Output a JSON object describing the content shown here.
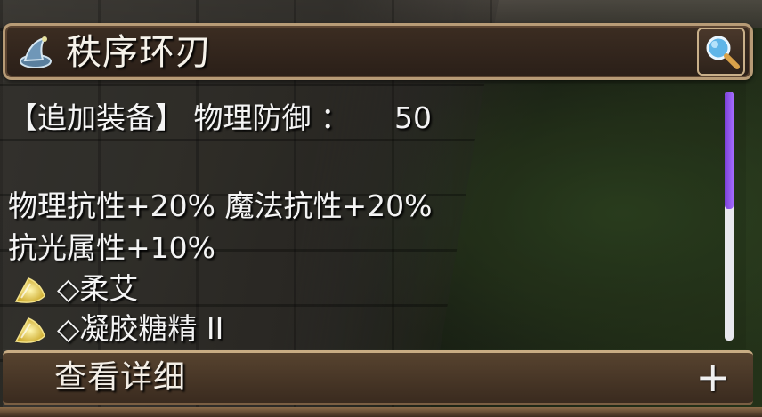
{
  "item": {
    "icon": "mage-hat-icon",
    "name": "秩序环刃",
    "search_icon": "magnifier-icon"
  },
  "stats": {
    "slot_label": "【追加装备】 物理防御 ：",
    "defense_value": "50",
    "resist_line": "物理抗性+20% 魔法抗性+20%",
    "light_line": "抗光属性+10%"
  },
  "options": [
    {
      "icon": "yellow-gem-icon",
      "label": "◇柔艾"
    },
    {
      "icon": "yellow-gem-icon",
      "label": "◇凝胶糖精 II"
    }
  ],
  "scrollbar": {
    "thumb_color": "#8b52ea",
    "position_fraction": 0.0
  },
  "footer": {
    "label": "查看详细",
    "expand_symbol": "+"
  },
  "colors": {
    "frame_gold": "#b79b76",
    "text": "#f4f4f4",
    "panel_brown": "#3c2d22"
  }
}
